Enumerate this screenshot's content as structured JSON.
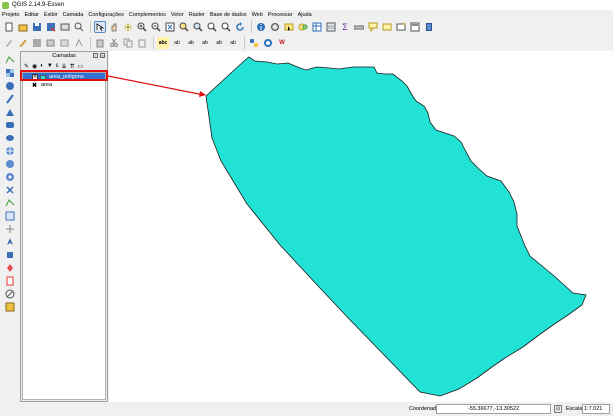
{
  "window": {
    "title": "QGIS 2.14.9-Essen"
  },
  "menu": [
    "Projeto",
    "Editar",
    "Exibir",
    "Camada",
    "Configurações",
    "Complementos",
    "Vetor",
    "Raster",
    "Base de dados",
    "Web",
    "Processar",
    "Ajuda"
  ],
  "toolbar_row1_icons": [
    "new-project-icon",
    "open-project-icon",
    "save-project-icon",
    "save-as-icon",
    "print-composer-icon",
    "composer-manager-icon",
    "pan-icon",
    "touch-zoom-icon",
    "pan-to-selection-icon",
    "zoom-in-icon",
    "zoom-out-icon",
    "zoom-full-icon",
    "zoom-selection-icon",
    "zoom-layer-icon",
    "zoom-last-icon",
    "zoom-next-icon",
    "refresh-icon",
    "identify-icon",
    "actions-icon",
    "select-icon",
    "deselect-icon",
    "attribute-table-icon",
    "statistics-icon",
    "measure-icon",
    "annotation-icon",
    "bookmarks-icon",
    "tips-icon",
    "map-tips-icon",
    "show-bookmarks-icon"
  ],
  "toolbar_row2_icons": [
    "current-edits-icon",
    "toggle-editing-icon",
    "save-edits-icon",
    "add-feature-icon",
    "move-feature-icon",
    "node-tool-icon",
    "delete-selected-icon",
    "cut-features-icon",
    "copy-features-icon",
    "paste-features-icon",
    "label-icon",
    "pin-labels-icon",
    "show-hide-labels-icon",
    "move-label-icon",
    "rotate-label-icon",
    "change-label-icon",
    "python-console-icon",
    "openlayers-icon",
    "wms-icon"
  ],
  "left_toolbar_icons": [
    "add-vector-layer-icon",
    "add-raster-layer-icon",
    "add-postgis-icon",
    "add-spatialite-icon",
    "add-mssql-icon",
    "add-oracle-icon",
    "add-db2-icon",
    "add-wms-icon",
    "add-wcs-icon",
    "add-wfs-icon",
    "add-delimited-text-icon",
    "add-virtual-layer-icon",
    "new-shapefile-icon",
    "new-spatialite-layer-icon",
    "gps-icon",
    "gdal-icon",
    "georeferencer-icon",
    "grass-icon",
    "processing-icon",
    "style-dock-icon"
  ],
  "layers_panel": {
    "title": "Camadas",
    "layers": [
      {
        "name": "area_poligono",
        "checked": true,
        "type": "polygon",
        "color": "#22e2d6"
      },
      {
        "name": "area",
        "checked": false,
        "type": "point"
      }
    ]
  },
  "map": {
    "fill_color": "#22e2d6",
    "annotation_color": "#e01010"
  },
  "statusbar": {
    "coordinate_label": "Coordenada",
    "coordinate_value": "-55.36677,-13.30522",
    "scale_label": "Escala",
    "scale_value": "1:7.021"
  }
}
